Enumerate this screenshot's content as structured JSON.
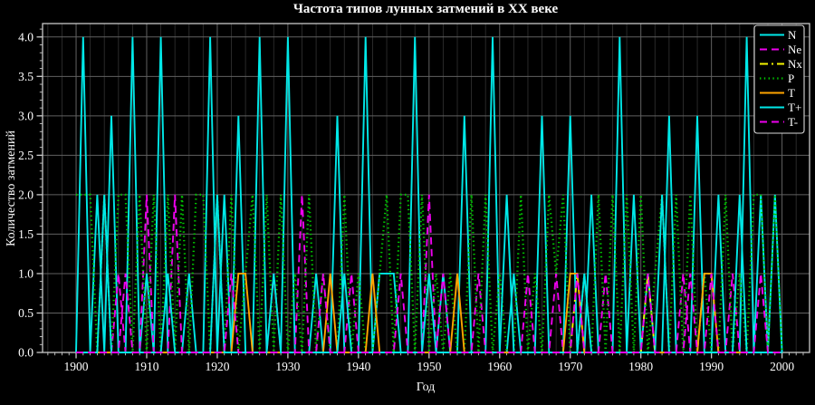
{
  "chart_data": {
    "type": "line",
    "title": "Частота типов лунных затмений в XX веке",
    "xlabel": "Год",
    "ylabel": "Количество затмений",
    "xlim": [
      1895.25,
      2003.9
    ],
    "ylim": [
      0,
      4.17
    ],
    "grid": "major vertical every 10 years, minor vertical every 2 years, horizontal every 0.5",
    "legend_position": "upper right",
    "xtick_values": [
      1900,
      1910,
      1920,
      1930,
      1940,
      1950,
      1960,
      1970,
      1980,
      1990,
      2000
    ],
    "xtick_labels": [
      "1900",
      "1910",
      "1920",
      "1930",
      "1940",
      "1950",
      "1960",
      "1970",
      "1980",
      "1990",
      "2000"
    ],
    "ytick_values": [
      0,
      0.5,
      1,
      1.5,
      2,
      2.5,
      3,
      3.5,
      4
    ],
    "ytick_labels": [
      "0.0",
      "0.5",
      "1.0",
      "1.5",
      "2.0",
      "2.5",
      "3.0",
      "3.5",
      "4.0"
    ],
    "x_minor_tick_step": 1,
    "x_minor_grid_step": 2,
    "y_minor_tick_step": 0.1,
    "colors": {
      "cyan": "#00e8e8",
      "magenta": "#ee00ee",
      "yellow": "#f5f500",
      "green": "#00c400",
      "orange": "#ffa500",
      "text": "#ffffff",
      "grid_major": "#616161",
      "grid_minor": "#2e2e2e",
      "spine": "#c8c8c8",
      "background": "#000000"
    },
    "years": [
      1900,
      1901,
      1902,
      1903,
      1904,
      1905,
      1906,
      1907,
      1908,
      1909,
      1910,
      1911,
      1912,
      1913,
      1914,
      1915,
      1916,
      1917,
      1918,
      1919,
      1920,
      1921,
      1922,
      1923,
      1924,
      1925,
      1926,
      1927,
      1928,
      1929,
      1930,
      1931,
      1932,
      1933,
      1934,
      1935,
      1936,
      1937,
      1938,
      1939,
      1940,
      1941,
      1942,
      1943,
      1944,
      1945,
      1946,
      1947,
      1948,
      1949,
      1950,
      1951,
      1952,
      1953,
      1954,
      1955,
      1956,
      1957,
      1958,
      1959,
      1960,
      1961,
      1962,
      1963,
      1964,
      1965,
      1966,
      1967,
      1968,
      1969,
      1970,
      1971,
      1972,
      1973,
      1974,
      1975,
      1976,
      1977,
      1978,
      1979,
      1980,
      1981,
      1982,
      1983,
      1984,
      1985,
      1986,
      1987,
      1988,
      1989,
      1990,
      1991,
      1992,
      1993,
      1994,
      1995,
      1996,
      1997,
      1998,
      1999,
      2000
    ],
    "series": [
      {
        "name": "N",
        "color": "#00e8e8",
        "style": "solid",
        "values": [
          0,
          4,
          0,
          2,
          0,
          3,
          0,
          0,
          4,
          0,
          1,
          0,
          4,
          0,
          0,
          0,
          1,
          0,
          0,
          4,
          0,
          2,
          0,
          3,
          0,
          0,
          4,
          0,
          0,
          0,
          4,
          0,
          0,
          0,
          1,
          0,
          0,
          3,
          0,
          0,
          0,
          4,
          0,
          1,
          1,
          1,
          0,
          0,
          4,
          0,
          0,
          0,
          1,
          0,
          0,
          3,
          0,
          0,
          0,
          4,
          0,
          0,
          1,
          0,
          0,
          0,
          3,
          0,
          0,
          0,
          3,
          0,
          0,
          2,
          0,
          0,
          0,
          4,
          0,
          2,
          0,
          1,
          0,
          0,
          3,
          0,
          0,
          0,
          3,
          0,
          0,
          2,
          0,
          0,
          0,
          4,
          0,
          2,
          0,
          2,
          0
        ]
      },
      {
        "name": "Ne",
        "color": "#ee00ee",
        "style": "dashed",
        "values": [
          0,
          0,
          0,
          0,
          0,
          0,
          1,
          0,
          0,
          0,
          2,
          0,
          0,
          0,
          2,
          0,
          0,
          0,
          0,
          0,
          0,
          0,
          0,
          0,
          0,
          0,
          0,
          0,
          1,
          0,
          0,
          0,
          2,
          0,
          0,
          0,
          0,
          0,
          0,
          1,
          0,
          0,
          0,
          0,
          0,
          0,
          0,
          0,
          0,
          0,
          2,
          0,
          0,
          0,
          0,
          0,
          0,
          1,
          0,
          0,
          0,
          0,
          0,
          0,
          0,
          0,
          0,
          0,
          1,
          0,
          0,
          0,
          0,
          0,
          0,
          1,
          0,
          0,
          0,
          0,
          0,
          0,
          0,
          0,
          0,
          0,
          1,
          0,
          0,
          0,
          0,
          0,
          0,
          1,
          0,
          0,
          0,
          0,
          0,
          0,
          0
        ]
      },
      {
        "name": "Nx",
        "color": "#f5f500",
        "style": "dashdot",
        "values": [
          0,
          0,
          0,
          0,
          0,
          0,
          0,
          0,
          0,
          0,
          0,
          0,
          0,
          0,
          0,
          0,
          0,
          0,
          0,
          0,
          0,
          0,
          0,
          0,
          0,
          0,
          0,
          0,
          0,
          0,
          0,
          0,
          0,
          0,
          0,
          0,
          0,
          0,
          0,
          0,
          0,
          0,
          0,
          0,
          0,
          0,
          0,
          0,
          0,
          0,
          0,
          0,
          0,
          0,
          0,
          0,
          0,
          0,
          0,
          0,
          0,
          0,
          0,
          0,
          0,
          0,
          0,
          0,
          0,
          0,
          0,
          1,
          0,
          0,
          0,
          0,
          0,
          0,
          0,
          0,
          0,
          1,
          0,
          0,
          0,
          0,
          0,
          0,
          0,
          1,
          1,
          0,
          0,
          0,
          0,
          0,
          0,
          0,
          0,
          0,
          0
        ]
      },
      {
        "name": "P",
        "color": "#00c400",
        "style": "dotted",
        "values": [
          2,
          2,
          2,
          0,
          2,
          0,
          2,
          2,
          0,
          2,
          0,
          2,
          0,
          2,
          0,
          2,
          0,
          2,
          2,
          0,
          2,
          0,
          2,
          0,
          1,
          2,
          0,
          2,
          0,
          2,
          0,
          1,
          0,
          2,
          0,
          1,
          0,
          0,
          2,
          0,
          1,
          0,
          0,
          1,
          2,
          0,
          2,
          2,
          0,
          2,
          0,
          1,
          0,
          1,
          0,
          0,
          2,
          0,
          2,
          0,
          1,
          0,
          0,
          2,
          0,
          1,
          0,
          2,
          1,
          2,
          0,
          0,
          1,
          0,
          2,
          0,
          2,
          0,
          2,
          0,
          2,
          0,
          1,
          2,
          0,
          2,
          0,
          2,
          0,
          1,
          0,
          0,
          2,
          0,
          1,
          0,
          2,
          2,
          0,
          2,
          0
        ]
      },
      {
        "name": "T",
        "color": "#ffa500",
        "style": "solid",
        "values": [
          0,
          0,
          0,
          0,
          0,
          0,
          0,
          0,
          0,
          0,
          0,
          0,
          0,
          0,
          0,
          0,
          0,
          0,
          0,
          0,
          0,
          0,
          0,
          1,
          1,
          0,
          0,
          0,
          0,
          0,
          0,
          0,
          0,
          0,
          0,
          0,
          1,
          0,
          0,
          0,
          0,
          0,
          1,
          0,
          0,
          0,
          0,
          0,
          0,
          0,
          0,
          0,
          0,
          0,
          1,
          0,
          0,
          0,
          0,
          0,
          0,
          0,
          0,
          0,
          0,
          0,
          0,
          0,
          0,
          0,
          1,
          1,
          0,
          0,
          0,
          0,
          0,
          0,
          0,
          0,
          0,
          0,
          0,
          0,
          0,
          0,
          0,
          0,
          0,
          1,
          1,
          0,
          0,
          0,
          0,
          0,
          0,
          0,
          0,
          0,
          0
        ]
      },
      {
        "name": "T+",
        "color": "#00e8e8",
        "style": "solid",
        "values": [
          0,
          0,
          0,
          0,
          2,
          0,
          0,
          0,
          0,
          0,
          0,
          0,
          0,
          1,
          0,
          0,
          0,
          0,
          0,
          0,
          2,
          0,
          0,
          0,
          0,
          0,
          0,
          0,
          1,
          0,
          0,
          0,
          0,
          0,
          0,
          0,
          0,
          0,
          1,
          0,
          0,
          0,
          0,
          0,
          0,
          0,
          0,
          0,
          0,
          0,
          1,
          0,
          0,
          0,
          0,
          0,
          0,
          0,
          0,
          0,
          0,
          2,
          0,
          0,
          0,
          0,
          0,
          0,
          0,
          0,
          0,
          0,
          1,
          0,
          0,
          0,
          0,
          0,
          0,
          0,
          0,
          0,
          0,
          2,
          0,
          0,
          0,
          0,
          0,
          0,
          0,
          0,
          0,
          0,
          2,
          0,
          0,
          0,
          0,
          0,
          0
        ]
      },
      {
        "name": "T-",
        "color": "#ee00ee",
        "style": "dashed",
        "values": [
          0,
          0,
          0,
          0,
          0,
          0,
          0,
          1,
          0,
          0,
          0,
          0,
          0,
          0,
          0,
          0,
          0,
          0,
          0,
          0,
          0,
          0,
          1,
          0,
          0,
          0,
          0,
          0,
          0,
          0,
          0,
          0,
          0,
          0,
          0,
          1,
          0,
          0,
          0,
          0,
          0,
          0,
          0,
          0,
          0,
          0,
          1,
          0,
          0,
          0,
          0,
          0,
          1,
          0,
          0,
          0,
          0,
          0,
          0,
          0,
          0,
          0,
          0,
          0,
          1,
          0,
          0,
          0,
          0,
          0,
          0,
          1,
          0,
          0,
          0,
          0,
          0,
          0,
          0,
          0,
          0,
          1,
          0,
          0,
          0,
          0,
          0,
          1,
          0,
          0,
          1,
          0,
          0,
          0,
          0,
          0,
          0,
          1,
          0,
          0,
          0
        ]
      }
    ]
  }
}
